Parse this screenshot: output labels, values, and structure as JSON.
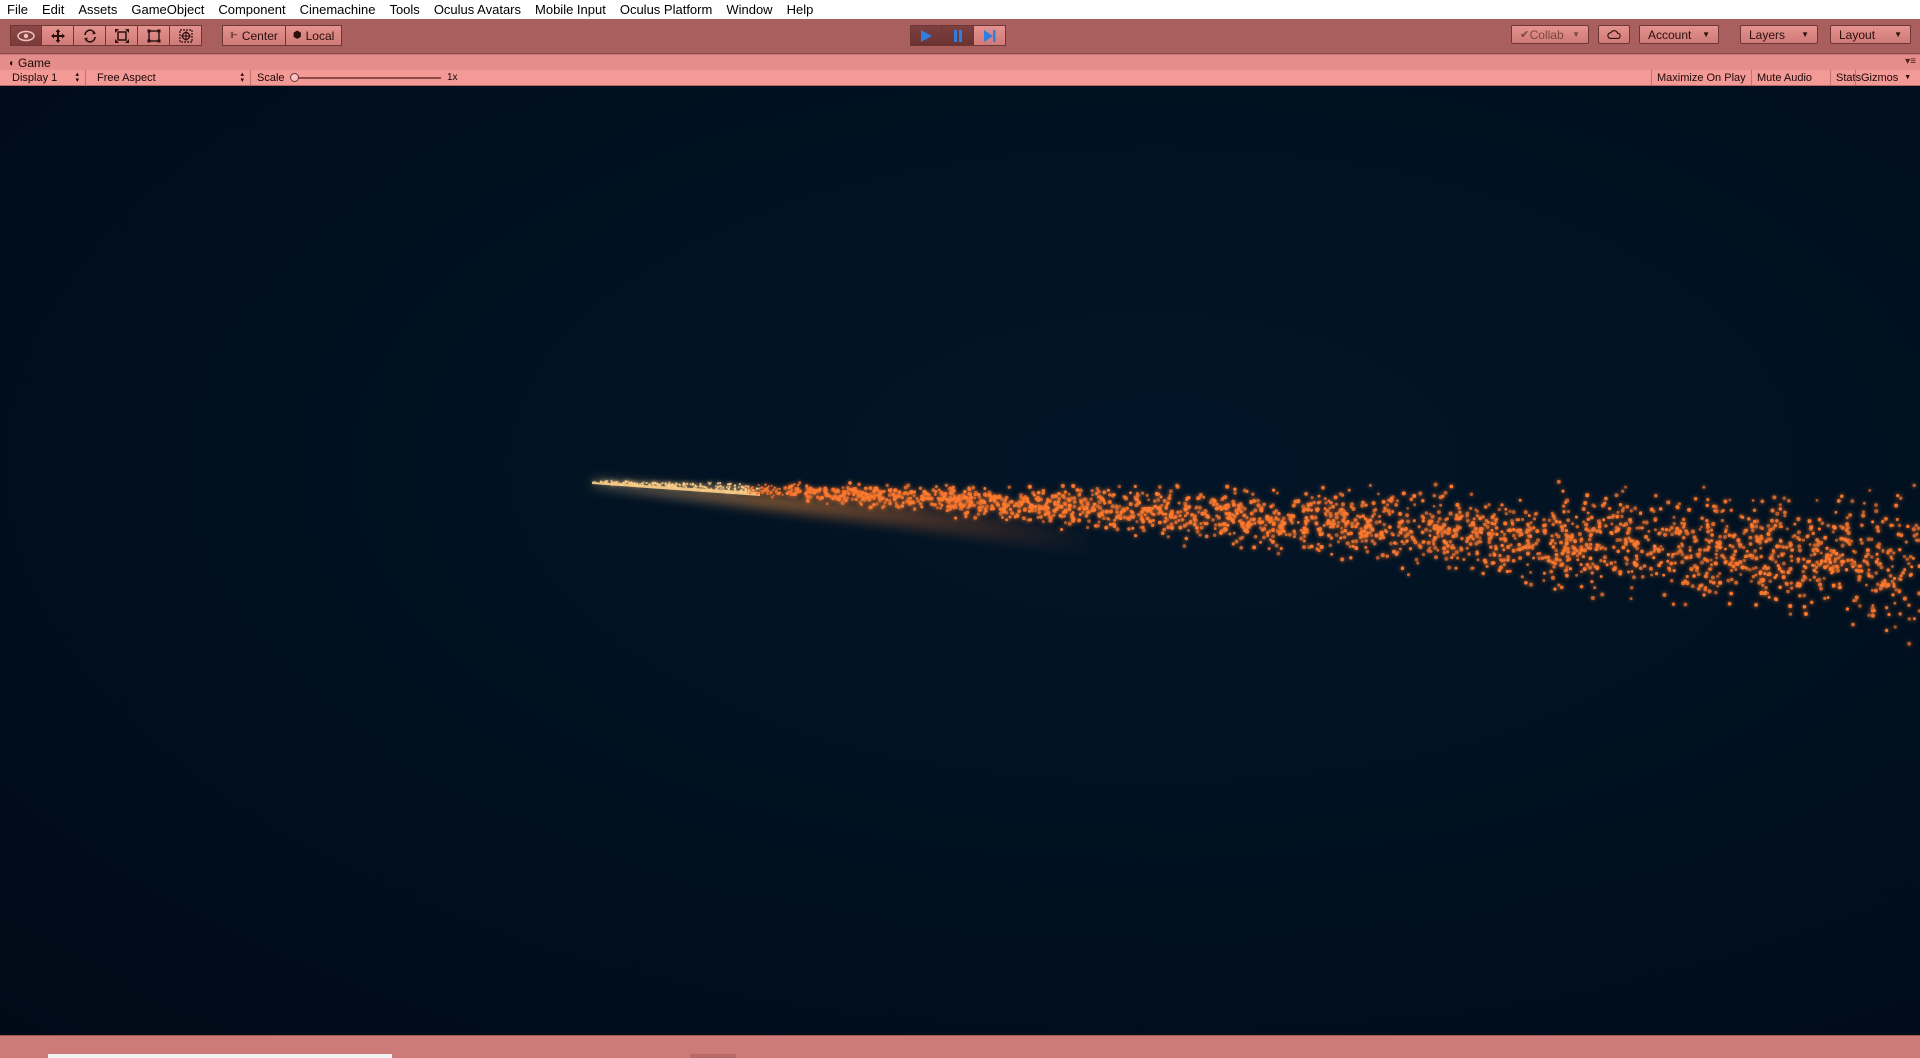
{
  "menu": [
    "File",
    "Edit",
    "Assets",
    "GameObject",
    "Component",
    "Cinemachine",
    "Tools",
    "Oculus Avatars",
    "Mobile Input",
    "Oculus Platform",
    "Window",
    "Help"
  ],
  "toolbar": {
    "tools": [
      {
        "name": "hand-tool",
        "icon": "eye-icon",
        "active": true
      },
      {
        "name": "move-tool",
        "icon": "move-icon",
        "active": false
      },
      {
        "name": "rotate-tool",
        "icon": "rotate-icon",
        "active": false
      },
      {
        "name": "scale-tool",
        "icon": "scale-icon",
        "active": false
      },
      {
        "name": "rect-tool",
        "icon": "rect-icon",
        "active": false
      },
      {
        "name": "transform-tool",
        "icon": "transform-icon",
        "active": false
      }
    ],
    "pivot_mode": "Center",
    "pivot_rotation": "Local",
    "play": {
      "playing": true,
      "paused": true
    },
    "collab_label": "Collab",
    "account_label": "Account",
    "layers_label": "Layers",
    "layout_label": "Layout"
  },
  "game_tab": {
    "title": "Game"
  },
  "view_toolbar": {
    "display": "Display 1",
    "aspect": "Free Aspect",
    "scale_label": "Scale",
    "scale_value": "1x",
    "maximize_on_play": "Maximize On Play",
    "mute_audio": "Mute Audio",
    "stats": "Stats",
    "gizmos": "Gizmos"
  },
  "colors": {
    "playmode_tint": "#a85f5d",
    "particle": "#ff7a2e",
    "particle_core": "#ffd08a",
    "background": "#010c1c",
    "play_accent": "#2f7fe0"
  }
}
